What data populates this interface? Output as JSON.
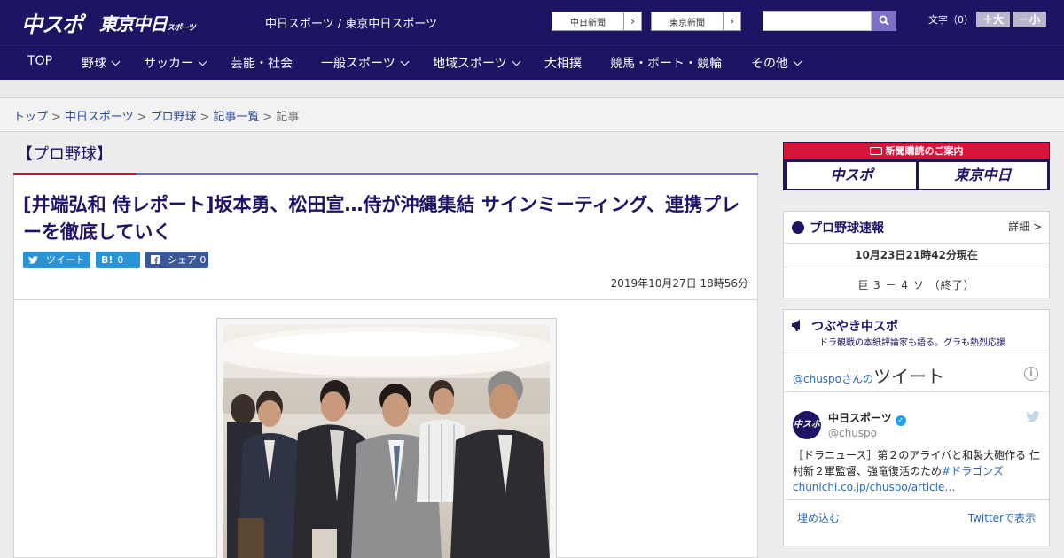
{
  "header": {
    "logo_main": "中スポ",
    "logo_tokyo": "東京中日",
    "logo_tokyo_small": "スポーツ",
    "site_links": "中日スポーツ / 東京中日スポーツ",
    "paper_buttons": [
      {
        "label": "中日新聞",
        "arrow": "›"
      },
      {
        "label": "東京新聞",
        "arrow": "›"
      }
    ],
    "search_placeholder": "",
    "font_size_label": "文字（0）",
    "font_bigger": "＋大",
    "font_smaller": "－小"
  },
  "nav": {
    "items": [
      {
        "label": "TOP",
        "has_menu": false
      },
      {
        "label": "野球",
        "has_menu": true
      },
      {
        "label": "サッカー",
        "has_menu": true
      },
      {
        "label": "芸能・社会",
        "has_menu": false
      },
      {
        "label": "一般スポーツ",
        "has_menu": true
      },
      {
        "label": "地域スポーツ",
        "has_menu": true
      },
      {
        "label": "大相撲",
        "has_menu": false
      },
      {
        "label": "競馬・ボート・競輪",
        "has_menu": false
      },
      {
        "label": "その他",
        "has_menu": true
      }
    ]
  },
  "breadcrumb": {
    "items": [
      "トップ",
      "中日スポーツ",
      "プロ野球",
      "記事一覧"
    ],
    "separator": ">",
    "current": "記事"
  },
  "article": {
    "category": "【プロ野球】",
    "headline": "[井端弘和 侍レポート]坂本勇、松田宣…侍が沖縄集結 サインミーティング、連携プレーを徹底していく",
    "share": {
      "tweet": "ツイート",
      "hatena_icon": "B!",
      "hatena_count": "0",
      "facebook_label": "シェア",
      "facebook_count": "0"
    },
    "date": "2019年10月27日 18時56分"
  },
  "sidebar": {
    "subscription": {
      "heading": "新聞購読のご案内",
      "buttons": [
        "中スポ",
        "東京中日"
      ]
    },
    "baseball": {
      "title": "プロ野球速報",
      "more": "詳細 >",
      "timestamp": "10月23日21時42分現在",
      "score": "巨 3 － 4 ソ （終了）"
    },
    "tweets": {
      "title": "つぶやき中スポ",
      "subtitle": "ドラ観戦の本紙評論家も語る。グラも熱烈応援",
      "header_user": "@chuspoさんの",
      "header_word": "ツイート",
      "avatar_text": "中スポ",
      "name": "中日スポーツ",
      "handle": "@chuspo",
      "text_plain": "［ドラニュース］第２のアライバと和製大砲作る 仁村新２軍監督、強竜復活のため",
      "text_link": "#ドラゴンズchunichi.co.jp/chuspo/article…",
      "embed_label": "埋め込む",
      "view_label": "Twitterで表示"
    }
  },
  "colors": {
    "brand_navy": "#1d1463",
    "accent_red": "#d7143a",
    "accent_purple": "#7a6fb2",
    "twitter_blue": "#1da1f2",
    "hatena_blue": "#2a93d5",
    "facebook_blue": "#3b5998"
  }
}
